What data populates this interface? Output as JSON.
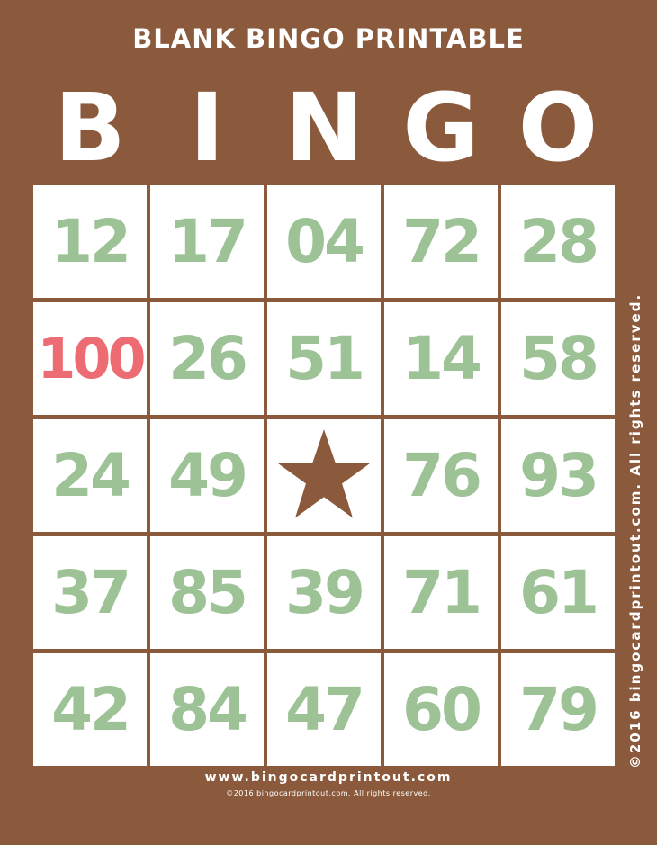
{
  "title": "BLANK BINGO PRINTABLE",
  "letters": [
    "B",
    "I",
    "N",
    "G",
    "O"
  ],
  "grid": [
    [
      "12",
      "17",
      "04",
      "72",
      "28"
    ],
    [
      "100",
      "26",
      "51",
      "14",
      "58"
    ],
    [
      "24",
      "49",
      "",
      "76",
      "93"
    ],
    [
      "37",
      "85",
      "39",
      "71",
      "61"
    ],
    [
      "42",
      "84",
      "47",
      "60",
      "79"
    ]
  ],
  "free_space": {
    "row": 2,
    "col": 2,
    "icon": "star-icon"
  },
  "highlighted_cell": {
    "row": 1,
    "col": 0
  },
  "side_text": "©2016 bingocardprintout.com. All rights reserved.",
  "footer": {
    "url": "www.bingocardprintout.com",
    "copyright": "©2016 bingocardprintout.com. All rights reserved."
  },
  "colors": {
    "background": "#8b5a3c",
    "cell": "#ffffff",
    "number": "#9cc296",
    "highlight": "#ed6b72",
    "star": "#8b5a3c",
    "text": "#ffffff"
  }
}
